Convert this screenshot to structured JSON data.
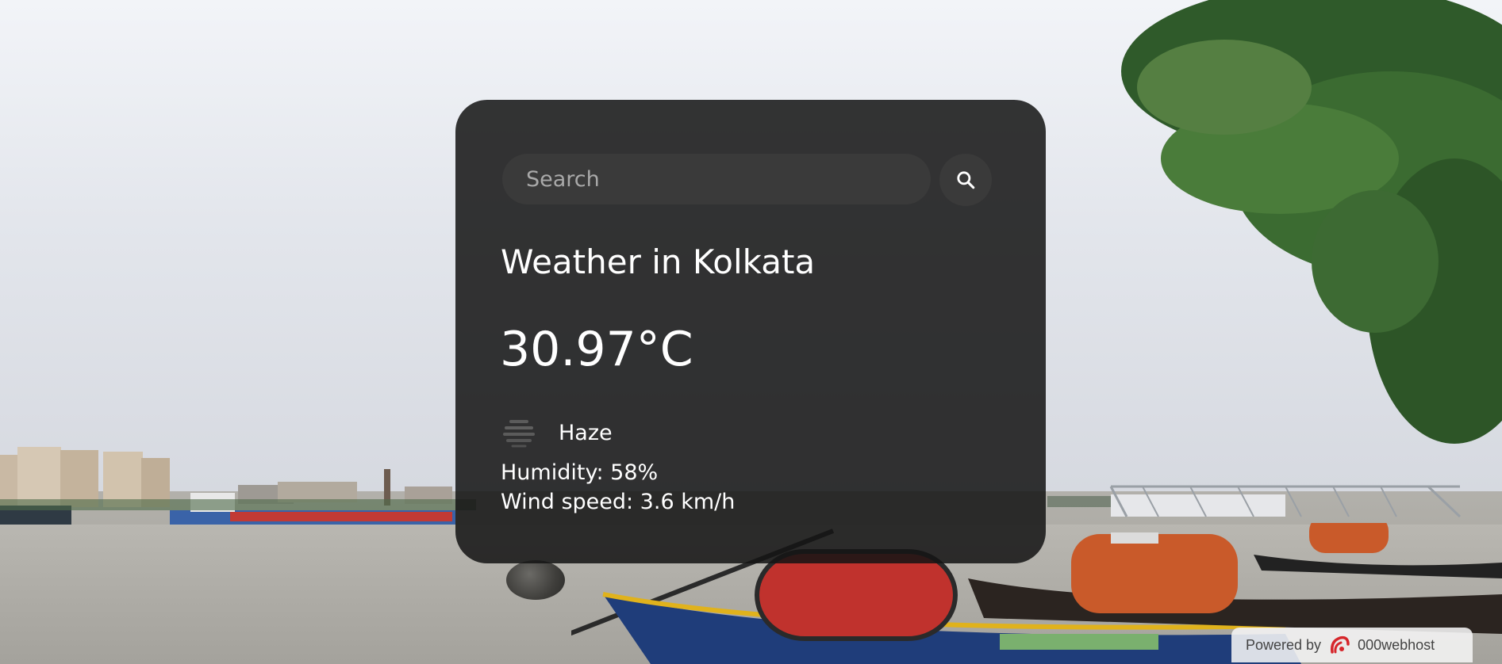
{
  "search": {
    "placeholder": "Search",
    "value": ""
  },
  "weather": {
    "title": "Weather in Kolkata",
    "temperature": "30.97°C",
    "condition": "Haze",
    "condition_icon": "haze-icon",
    "humidity": "Humidity: 58%",
    "wind": "Wind speed: 3.6 km/h"
  },
  "footer_badge": {
    "prefix": "Powered by",
    "brand": "000webhost",
    "logo_icon": "webhost-logo-icon"
  },
  "colors": {
    "card_background": "#141414",
    "input_background": "#3a3a3a",
    "text": "#ffffff",
    "placeholder": "#a9a9a9",
    "badge_logo": "#d6262b"
  }
}
